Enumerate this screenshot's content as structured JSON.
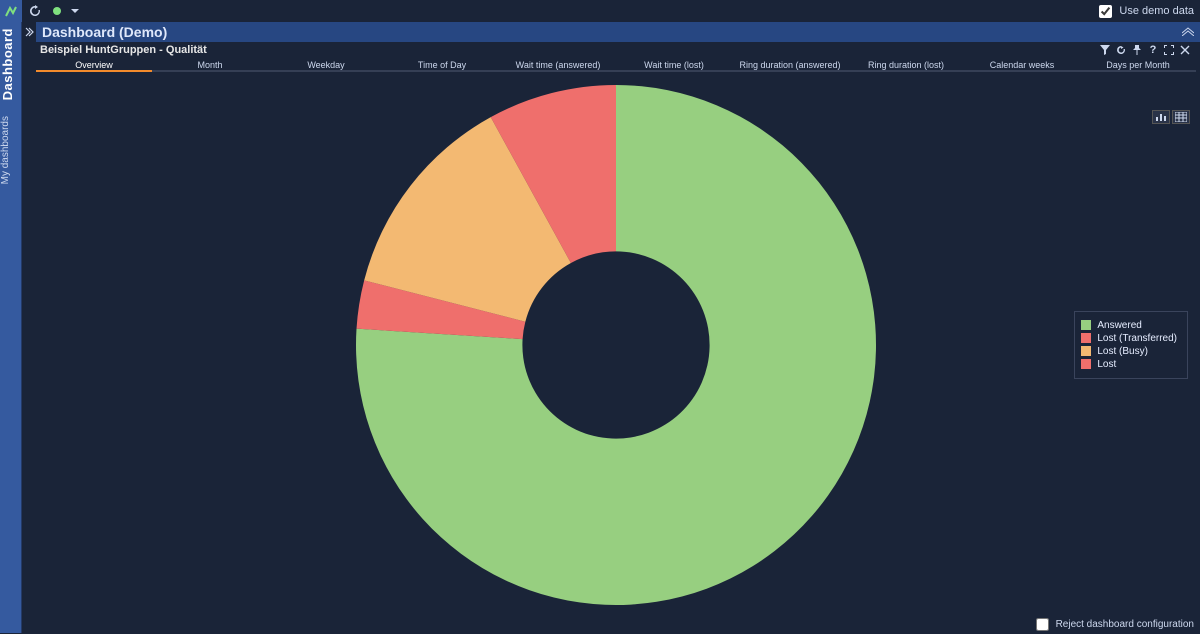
{
  "header": {
    "use_demo_data_label": "Use demo data",
    "use_demo_data_checked": true,
    "title": "Dashboard (Demo)"
  },
  "rail": {
    "main_tab": "Dashboard",
    "sub_tab": "My dashboards"
  },
  "widget": {
    "title": "Beispiel HuntGruppen - Qualität"
  },
  "tabs": [
    {
      "id": "overview",
      "label": "Overview",
      "active": true
    },
    {
      "id": "month",
      "label": "Month"
    },
    {
      "id": "weekday",
      "label": "Weekday"
    },
    {
      "id": "time_of_day",
      "label": "Time of Day"
    },
    {
      "id": "wait_answered",
      "label": "Wait time (answered)"
    },
    {
      "id": "wait_lost",
      "label": "Wait time (lost)"
    },
    {
      "id": "ring_answered",
      "label": "Ring duration (answered)"
    },
    {
      "id": "ring_lost",
      "label": "Ring duration (lost)"
    },
    {
      "id": "cal_weeks",
      "label": "Calendar weeks"
    },
    {
      "id": "days_per_month",
      "label": "Days per Month"
    }
  ],
  "legend": [
    {
      "label": "Answered",
      "color": "#97cf80"
    },
    {
      "label": "Lost (Transferred)",
      "color": "#ef6f6c"
    },
    {
      "label": "Lost (Busy)",
      "color": "#f3b972"
    },
    {
      "label": "Lost",
      "color": "#ef6f6c"
    }
  ],
  "footer": {
    "reject_label": "Reject dashboard configuration",
    "reject_checked": false
  },
  "chart_data": {
    "type": "pie",
    "title": "",
    "series": [
      {
        "name": "Answered",
        "value": 76,
        "color": "#97cf80"
      },
      {
        "name": "Lost (Transferred)",
        "value": 3,
        "color": "#ef6f6c"
      },
      {
        "name": "Lost (Busy)",
        "value": 13,
        "color": "#f3b972"
      },
      {
        "name": "Lost",
        "value": 8,
        "color": "#ef6f6c"
      }
    ],
    "donut_inner_ratio": 0.36
  }
}
